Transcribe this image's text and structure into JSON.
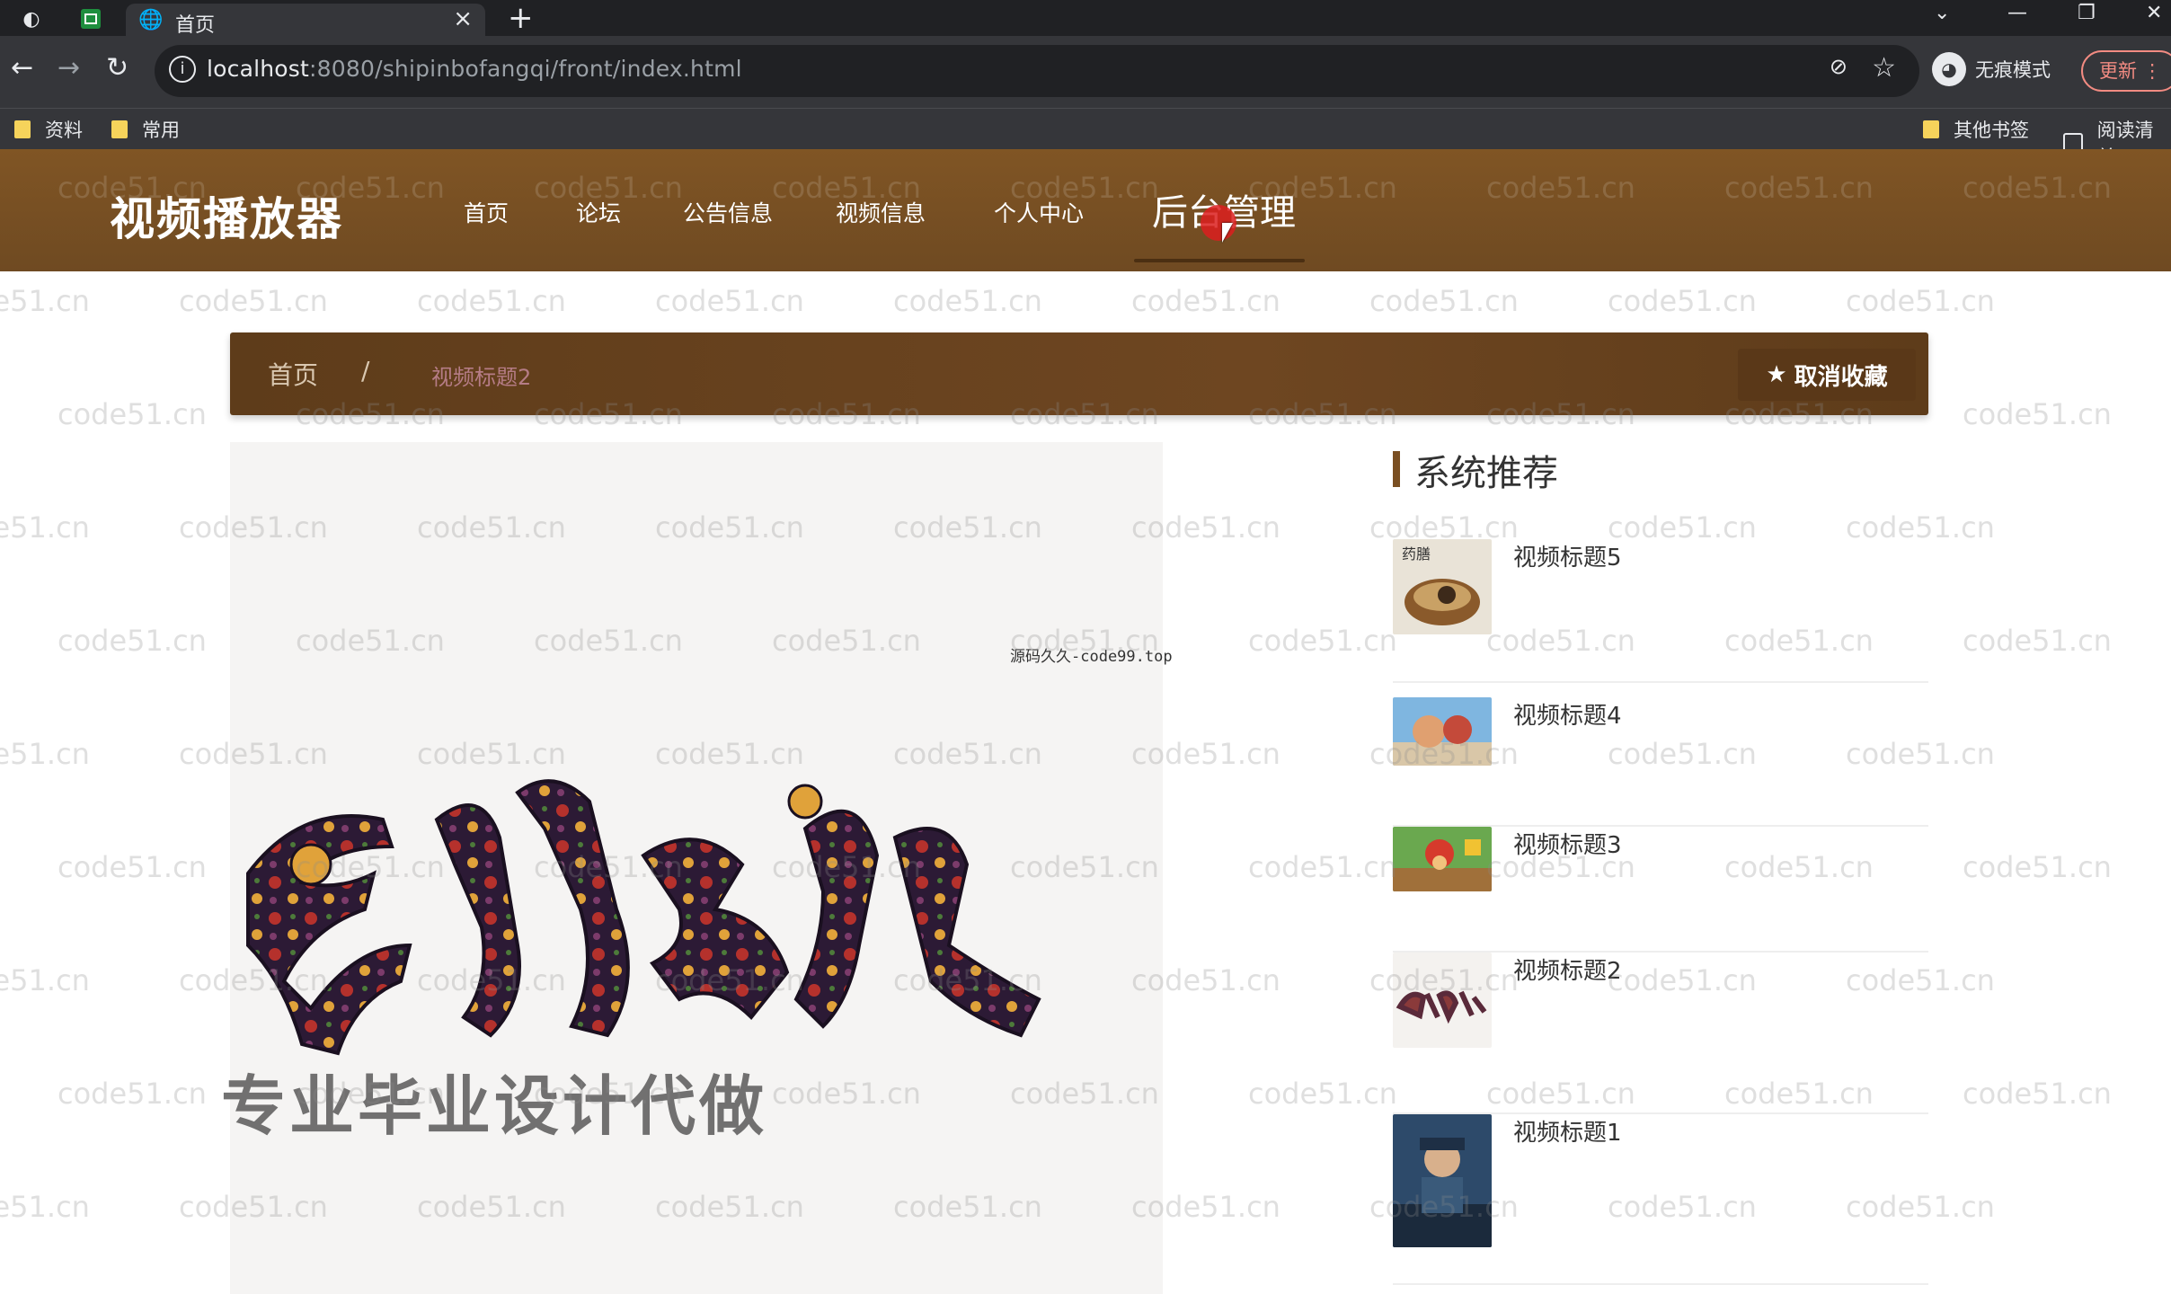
{
  "browser": {
    "active_tab_title": "首页",
    "url_host": "localhost",
    "url_rest": ":8080/shipinbofangqi/front/index.html",
    "incognito_label": "无痕模式",
    "update_label": "更新",
    "bookmarks": [
      "资料",
      "常用"
    ],
    "bookmarks_right": [
      "其他书签",
      "阅读清单"
    ]
  },
  "site": {
    "logo": "视频播放器",
    "nav": [
      "首页",
      "论坛",
      "公告信息",
      "视频信息",
      "个人中心",
      "后台管理"
    ]
  },
  "breadcrumb": {
    "home": "首页",
    "separator": "/",
    "current": "视频标题2"
  },
  "actions": {
    "unfavorite_label": "取消收藏"
  },
  "poster": {
    "caption": "专业毕业设计代做",
    "source_note": "源码久久-code99.top"
  },
  "recommend": {
    "title": "系统推荐",
    "items": [
      {
        "title": "视频标题5"
      },
      {
        "title": "视频标题4"
      },
      {
        "title": "视频标题3"
      },
      {
        "title": "视频标题2"
      },
      {
        "title": "视频标题1"
      }
    ]
  },
  "watermark_text": "code51.cn",
  "colors": {
    "header_brown": "#805524",
    "breadcrumb_brown": "#6e4621",
    "accent_bar": "#7a4f22"
  }
}
